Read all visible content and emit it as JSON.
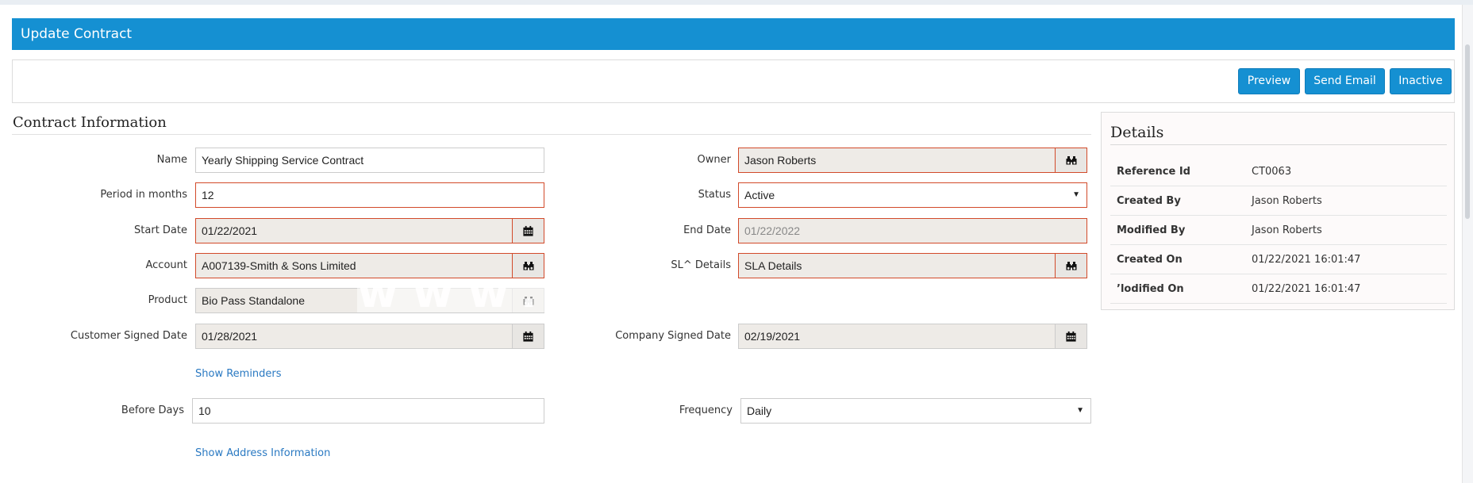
{
  "page": {
    "title": "Update Contract"
  },
  "toolbar": {
    "preview": "Preview",
    "send_email": "Send Email",
    "inactive": "Inactive"
  },
  "section": {
    "title": "Contract Information"
  },
  "form": {
    "name": {
      "label": "Name",
      "value": "Yearly Shipping Service Contract"
    },
    "owner": {
      "label": "Owner",
      "value": "Jason Roberts"
    },
    "period": {
      "label": "Period in months",
      "value": "12"
    },
    "status": {
      "label": "Status",
      "value": "Active"
    },
    "start_date": {
      "label": "Start Date",
      "value": "01/22/2021"
    },
    "end_date": {
      "label": "End Date",
      "value": "01/22/2022"
    },
    "account": {
      "label": "Account",
      "value": "A007139-Smith & Sons Limited"
    },
    "sla": {
      "label": "SL^ Details",
      "value": "SLA Details"
    },
    "product": {
      "label": "Product",
      "value": "Bio Pass Standalone"
    },
    "customer_signed": {
      "label": "Customer Signed Date",
      "value": "01/28/2021"
    },
    "company_signed": {
      "label": "Company Signed Date",
      "value": "02/19/2021"
    },
    "show_reminders": "Show Reminders",
    "before_days": {
      "label": "Before Days",
      "value": "10"
    },
    "frequency": {
      "label": "Frequency",
      "value": "Daily"
    },
    "show_address": "Show Address Information"
  },
  "details": {
    "title": "Details",
    "rows": [
      {
        "key": "Reference Id",
        "value": "CT0063"
      },
      {
        "key": "Created By",
        "value": "Jason Roberts"
      },
      {
        "key": "Modified By",
        "value": "Jason Roberts"
      },
      {
        "key": "Created On",
        "value": "01/22/2021 16:01:47"
      },
      {
        "key": "’lodified On",
        "value": "01/22/2021 16:01:47"
      }
    ]
  },
  "icons": {
    "lookup": "binoculars-icon",
    "calendar": "calendar-icon",
    "dropdown": "caret-down-icon"
  },
  "colors": {
    "accent": "#1590d2",
    "required_border": "#d24a2a",
    "readonly_bg": "#eeebe7",
    "link": "#2a79c2"
  },
  "watermark": "www.c"
}
